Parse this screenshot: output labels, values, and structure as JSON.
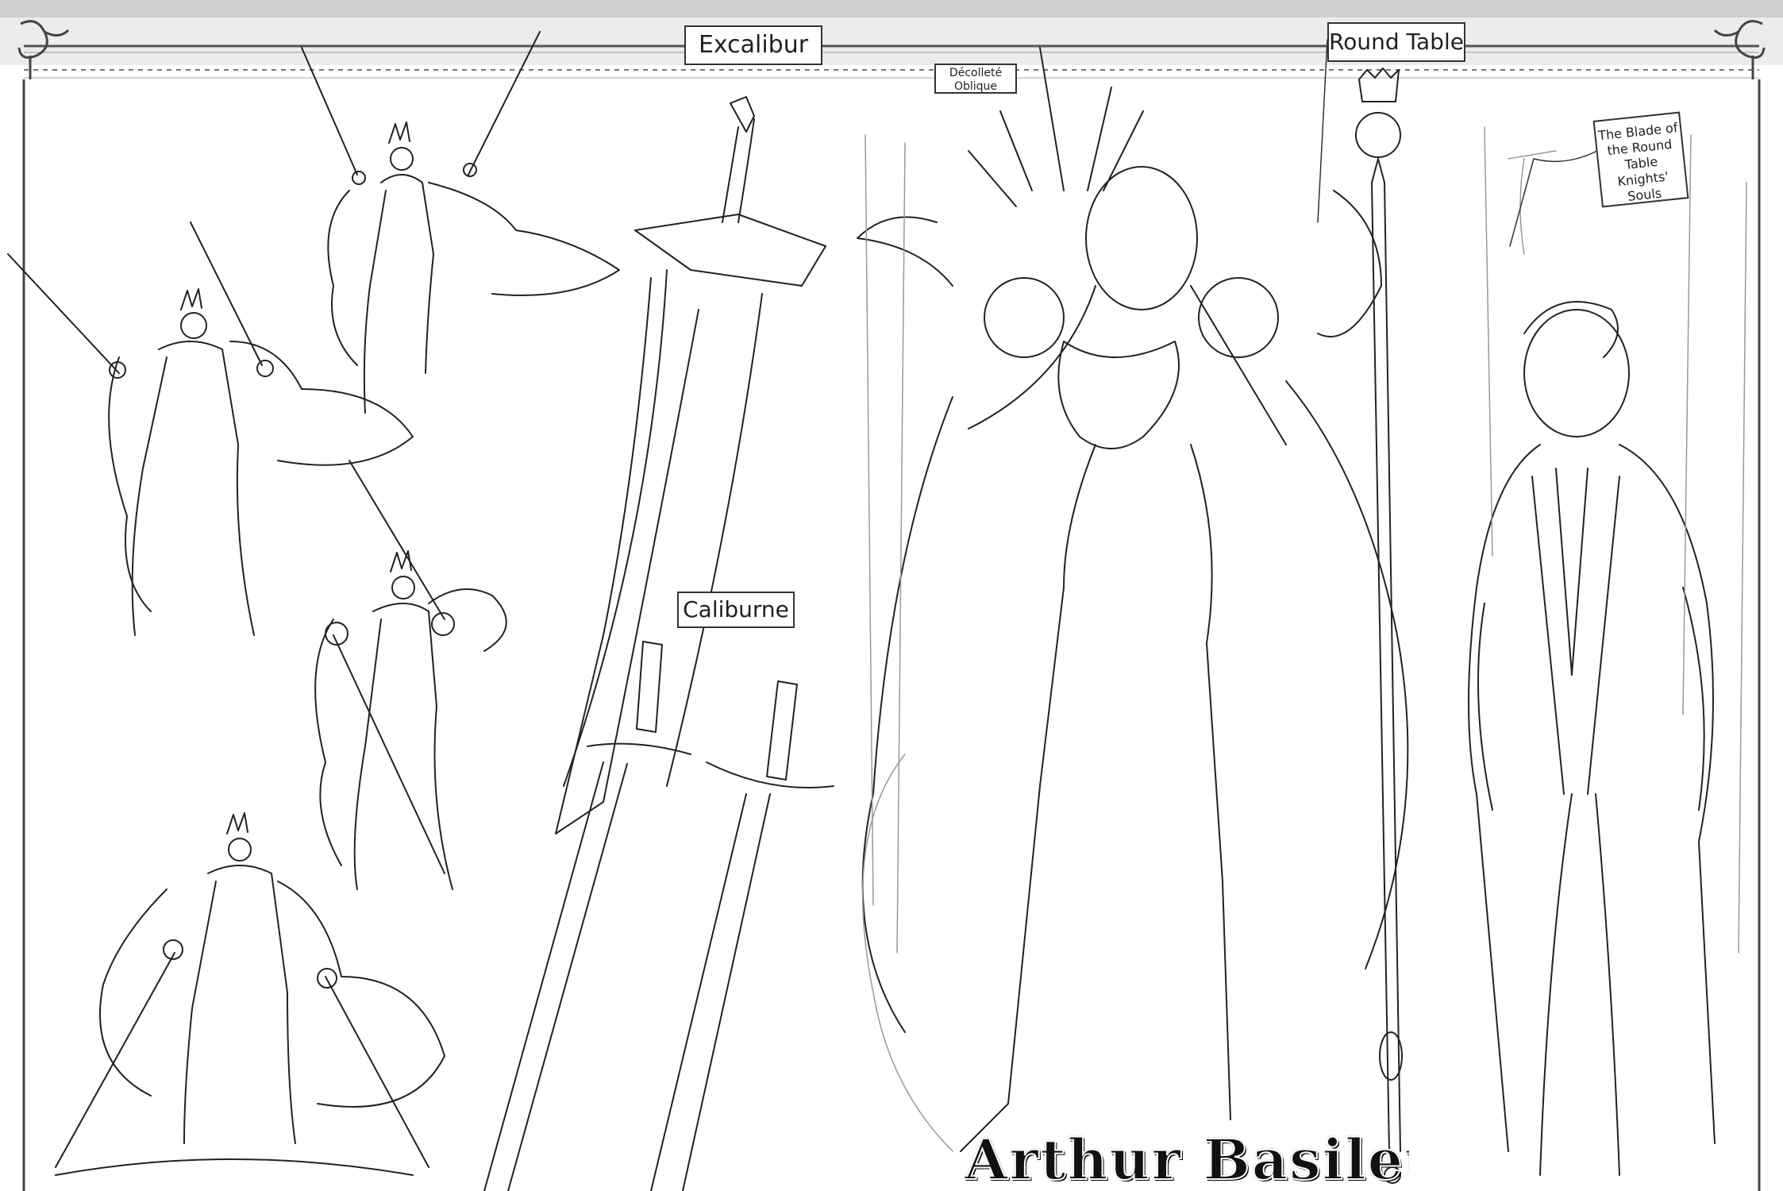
{
  "labels": {
    "excalibur": "Excalibur",
    "round_table": "Round Table",
    "decollete_line1": "Décolleté",
    "decollete_line2": "Oblique",
    "caliburne": "Caliburne",
    "blade_note": "The Blade of the Round Table Knights' Souls"
  },
  "title": "Arthur Basileus",
  "colors": {
    "ink": "#222222",
    "paper": "#ffffff",
    "frame": "#999999"
  }
}
